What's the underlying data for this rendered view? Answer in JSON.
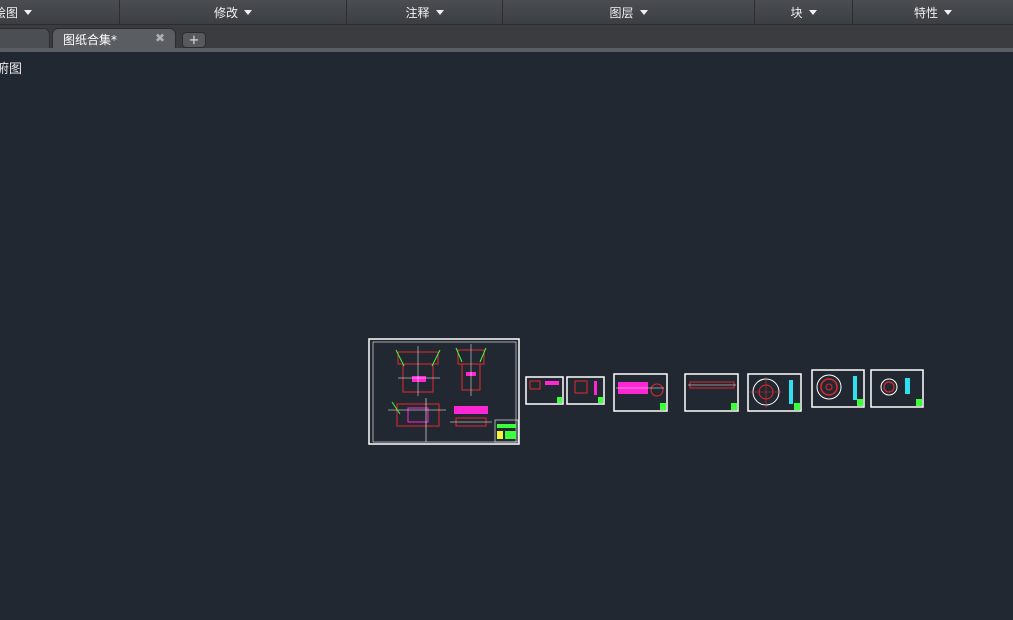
{
  "ribbon": {
    "panels": [
      {
        "label": "绘图"
      },
      {
        "label": "修改"
      },
      {
        "label": "注释"
      },
      {
        "label": "图层"
      },
      {
        "label": "块"
      },
      {
        "label": "特性"
      }
    ]
  },
  "tabs": {
    "active_label": "图纸合集*",
    "close_glyph": "✖",
    "add_glyph": "+"
  },
  "viewport": {
    "label": "俯图"
  },
  "colors": {
    "canvas_bg": "#222831",
    "sheet_border": "#ffffff",
    "red": "#e0282f",
    "magenta": "#ff26d4",
    "green": "#3cff3c",
    "cyan": "#2ee0f0",
    "yellow": "#f3f33a"
  }
}
